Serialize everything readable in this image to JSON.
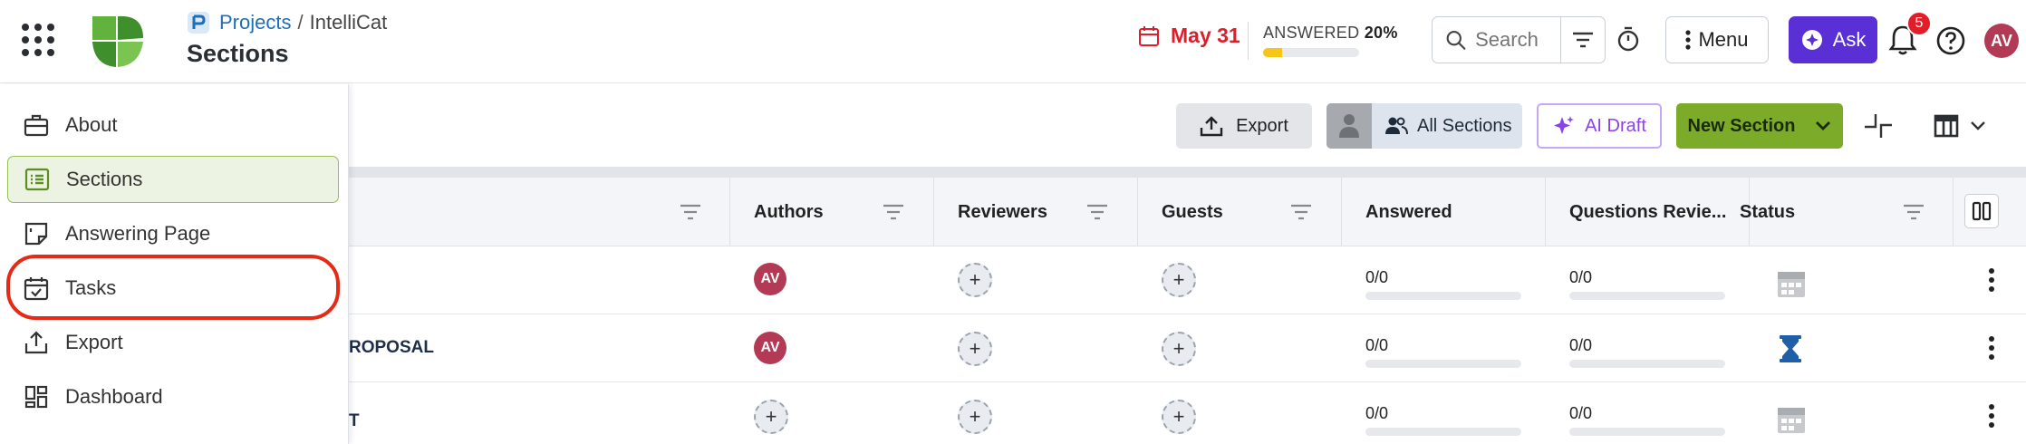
{
  "header": {
    "breadcrumb": {
      "root": "Projects",
      "separator": "/",
      "current": "IntelliCat"
    },
    "page_title": "Sections",
    "due_date": "May 31",
    "answered": {
      "label": "ANSWERED",
      "percent_text": "20%",
      "percent": 20
    },
    "search": {
      "placeholder": "Search"
    },
    "menu_label": "Menu",
    "ask_label": "Ask",
    "notification_count": "5",
    "user_initials": "AV"
  },
  "toolbar": {
    "export_label": "Export",
    "all_sections_label": "All Sections",
    "ai_draft_label": "AI Draft",
    "new_section_label": "New Section"
  },
  "table": {
    "columns": [
      "Authors",
      "Reviewers",
      "Guests",
      "Answered",
      "Questions Revie...",
      "Status"
    ],
    "rows": [
      {
        "name": "",
        "author": "AV",
        "answered": "0/0",
        "reviewed": "0/0",
        "status_icon": "calendar-icon"
      },
      {
        "name": "ROPOSAL",
        "author": "AV",
        "answered": "0/0",
        "reviewed": "0/0",
        "status_icon": "hourglass-icon"
      },
      {
        "name": "T",
        "author": "",
        "answered": "0/0",
        "reviewed": "0/0",
        "status_icon": "calendar-icon"
      }
    ]
  },
  "sidebar": {
    "items": [
      {
        "label": "About",
        "icon": "briefcase-icon"
      },
      {
        "label": "Sections",
        "icon": "list-icon",
        "active": true
      },
      {
        "label": "Answering Page",
        "icon": "note-icon"
      },
      {
        "label": "Tasks",
        "icon": "calendar-check-icon",
        "highlighted": true
      },
      {
        "label": "Export",
        "icon": "upload-icon"
      },
      {
        "label": "Dashboard",
        "icon": "dashboard-icon"
      }
    ]
  },
  "colors": {
    "accent_purple": "#5b2fd6",
    "new_section_green": "#7bab28",
    "due_red": "#e11d2a",
    "avatar": "#b23a54",
    "highlight": "#e52a16"
  }
}
